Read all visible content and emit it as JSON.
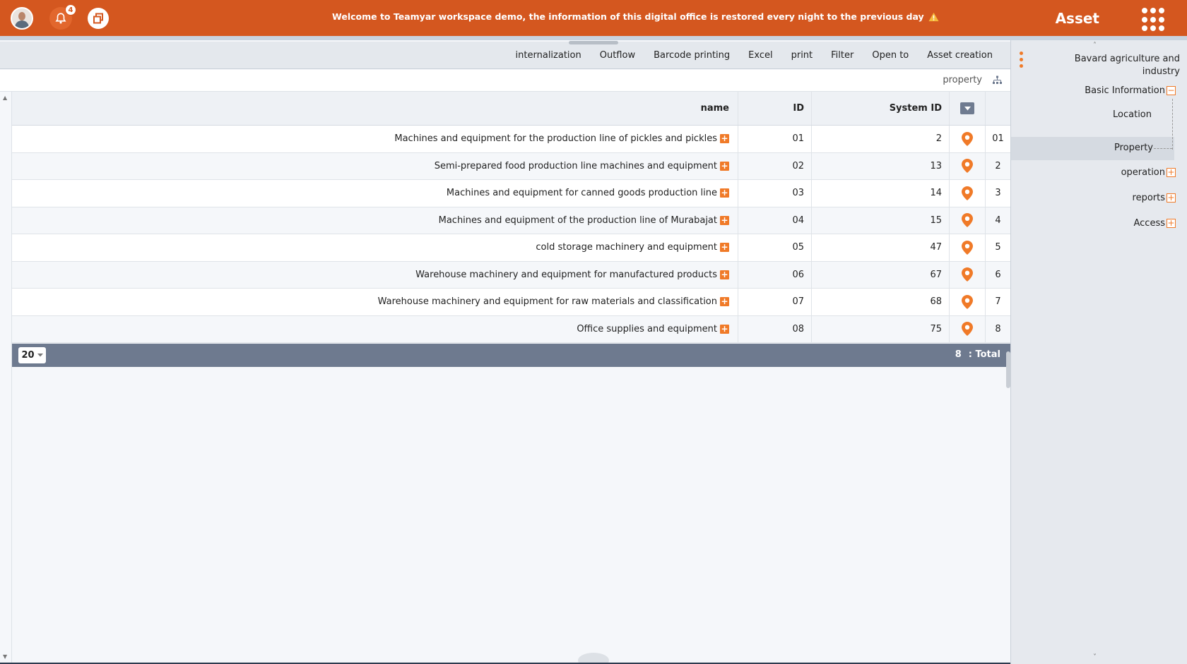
{
  "header": {
    "notification_count": "4",
    "welcome_text": "Welcome to Teamyar workspace demo, the information of this digital office is restored every night to the previous day",
    "app_title": "Asset",
    "brand_color": "#d4571f"
  },
  "toolbar": {
    "items": [
      "internalization",
      "Outflow",
      "Barcode printing",
      "Excel",
      "print",
      "Filter",
      "Open to",
      "Asset creation"
    ]
  },
  "subheader": {
    "label": "property"
  },
  "table": {
    "columns": {
      "name": "name",
      "id": "ID",
      "system_id": "System ID"
    },
    "rows": [
      {
        "name": "Machines and equipment for the production line of pickles and pickles",
        "id": "01",
        "system_id": "2",
        "row": "01"
      },
      {
        "name": "Semi-prepared food production line machines and equipment",
        "id": "02",
        "system_id": "13",
        "row": "2"
      },
      {
        "name": "Machines and equipment for canned goods production line",
        "id": "03",
        "system_id": "14",
        "row": "3"
      },
      {
        "name": "Machines and equipment of the production line of Murabajat",
        "id": "04",
        "system_id": "15",
        "row": "4"
      },
      {
        "name": "cold storage machinery and equipment",
        "id": "05",
        "system_id": "47",
        "row": "5"
      },
      {
        "name": "Warehouse machinery and equipment for manufactured products",
        "id": "06",
        "system_id": "67",
        "row": "6"
      },
      {
        "name": "Warehouse machinery and equipment for raw materials and classification",
        "id": "07",
        "system_id": "68",
        "row": "7"
      },
      {
        "name": "Office supplies and equipment",
        "id": "08",
        "system_id": "75",
        "row": "8"
      }
    ]
  },
  "footer": {
    "page_size": "20",
    "total_count": "8",
    "total_label": ": Total"
  },
  "sidebar": {
    "title": "Bavard agriculture and industry",
    "items": [
      {
        "label": "Basic Information",
        "toggle": "−"
      },
      {
        "label": "Location",
        "toggle": ""
      },
      {
        "label": "Property",
        "toggle": ""
      },
      {
        "label": "operation",
        "toggle": "+"
      },
      {
        "label": "reports",
        "toggle": "+"
      },
      {
        "label": "Access",
        "toggle": "+"
      }
    ],
    "accent_color": "#f07a28"
  }
}
